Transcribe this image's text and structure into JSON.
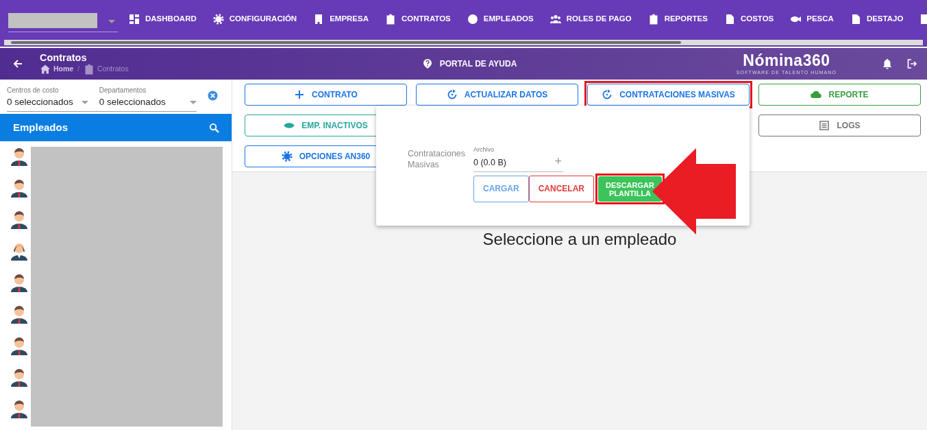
{
  "top_nav": {
    "items": [
      {
        "label": "DASHBOARD",
        "kind": "dashboard"
      },
      {
        "label": "CONFIGURACIÓN",
        "kind": "gear"
      },
      {
        "label": "EMPRESA",
        "kind": "building"
      },
      {
        "label": "CONTRATOS",
        "kind": "clipboard"
      },
      {
        "label": "EMPLEADOS",
        "kind": "face"
      },
      {
        "label": "ROLES DE PAGO",
        "kind": "group"
      },
      {
        "label": "REPORTES",
        "kind": "clipboard"
      },
      {
        "label": "COSTOS",
        "kind": "filedollar"
      },
      {
        "label": "PESCA",
        "kind": "fish"
      },
      {
        "label": "DESTAJO",
        "kind": "doc"
      },
      {
        "kind": "table"
      }
    ]
  },
  "header": {
    "title": "Contratos",
    "breadcrumb": [
      {
        "label": "Home",
        "kind": "home",
        "current": false
      },
      {
        "label": "Contratos",
        "kind": "clipboard",
        "current": true
      }
    ],
    "separator": "/",
    "help": "PORTAL DE AYUDA",
    "logo": {
      "name": "Nómina360",
      "tagline": "SOFTWARE DE TALENTO HUMANO"
    }
  },
  "filters": [
    {
      "label": "Centros de costo",
      "value": "0 seleccionados"
    },
    {
      "label": "Departamentos",
      "value": "0 seleccionados"
    }
  ],
  "employees": {
    "title": "Empleados",
    "items": [
      {
        "kind": "male"
      },
      {
        "kind": "male"
      },
      {
        "kind": "male"
      },
      {
        "kind": "female"
      },
      {
        "kind": "male"
      },
      {
        "kind": "male"
      },
      {
        "kind": "male"
      },
      {
        "kind": "male"
      },
      {
        "kind": "male"
      }
    ]
  },
  "toolbar": {
    "rows": [
      [
        {
          "label": "CONTRATO",
          "kind": "plus",
          "color": "#1a73e8",
          "highlighted": false
        },
        {
          "label": "ACTUALIZAR DATOS",
          "kind": "refresh",
          "color": "#1a73e8",
          "highlighted": false
        },
        {
          "label": "CONTRATACIONES MASIVAS",
          "kind": "refresh",
          "color": "#1a73e8",
          "highlighted": true
        },
        {
          "label": "REPORTE",
          "kind": "cloud",
          "color": "#3a9c3e",
          "highlighted": false
        }
      ],
      [
        {
          "label": "EMP. INACTIVOS",
          "kind": "eye",
          "color": "#26a69a",
          "highlighted": false
        },
        null,
        null,
        {
          "label": "LOGS",
          "kind": "list",
          "color": "#757575",
          "highlighted": false
        }
      ],
      [
        {
          "label": "OPCIONES AN360",
          "kind": "gear",
          "color": "#1a73e8",
          "highlighted": false
        }
      ]
    ]
  },
  "popup": {
    "title": "Contrataciones Masivas",
    "file_label": "Archivo",
    "file_value": "0 (0.0 B)",
    "add": "+",
    "buttons": [
      {
        "label": "CARGAR",
        "kind": "outlined",
        "color": "#64a6ee",
        "highlighted": false
      },
      {
        "label": "CANCELAR",
        "kind": "outlined",
        "color": "#e53935",
        "highlighted": false
      },
      {
        "label": "DESCARGAR PLANTILLA",
        "kind": "filled",
        "color": "#3cc35a",
        "highlighted": true
      }
    ]
  },
  "message": "Seleccione a un empleado"
}
